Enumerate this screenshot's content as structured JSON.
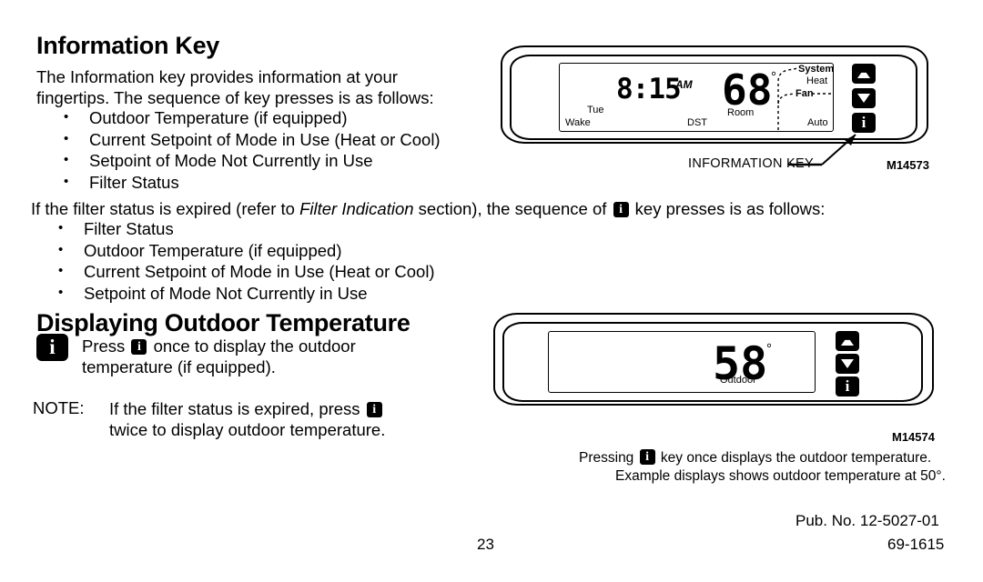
{
  "document": {
    "section1": {
      "heading": "Information Key",
      "intro_line1": "The Information key provides information at your",
      "intro_line2": "fingertips. The sequence of key presses is as follows:",
      "bullets": [
        "Outdoor Temperature (if equipped)",
        "Current Setpoint of Mode in Use (Heat or Cool)",
        "Setpoint of Mode Not Currently in Use",
        "Filter Status"
      ]
    },
    "section2": {
      "lead_part1": "If the filter status is expired (refer to ",
      "lead_italic": "Filter Indication",
      "lead_part2": " section), the sequence of ",
      "lead_part3": " key presses is as follows:",
      "bullets": [
        "Filter Status",
        "Outdoor Temperature (if equipped)",
        "Current Setpoint of Mode in Use (Heat or Cool)",
        "Setpoint of Mode Not Currently in Use"
      ]
    },
    "section3": {
      "heading": "Displaying Outdoor Temperature",
      "press_part1": "Press ",
      "press_part2": " once to display the outdoor",
      "press_line2": "temperature (if equipped).",
      "note_label": "NOTE:",
      "note_part1": "If the filter status is expired, press ",
      "note_line2": "twice to display outdoor temperature."
    }
  },
  "icons": {
    "info_key_glyph": "i",
    "info_key_name": "information-key-icon",
    "up_arrow_name": "up-arrow-icon",
    "down_arrow_name": "down-arrow-icon"
  },
  "figure_top": {
    "id": "M14573",
    "callout": "INFORMATION KEY",
    "display": {
      "time": "8:15",
      "meridiem": "AM",
      "temperature": "68",
      "degree": "°",
      "temp_label": "Room",
      "day": "Tue",
      "period": "Wake",
      "dst": "DST",
      "system_label": "System",
      "system_value": "Heat",
      "fan_label": "Fan",
      "fan_value": "Auto"
    }
  },
  "figure_bottom": {
    "id": "M14574",
    "display": {
      "temperature": "58",
      "degree": "°",
      "temp_label": "Outdoor"
    },
    "caption_part1": "Pressing ",
    "caption_part2": " key once displays the outdoor temperature.",
    "caption_line2": "Example displays shows outdoor temperature at 50°."
  },
  "footer": {
    "page_number": "23",
    "pub_no": "Pub. No. 12-5027-01",
    "doc_no": "69-1615"
  }
}
